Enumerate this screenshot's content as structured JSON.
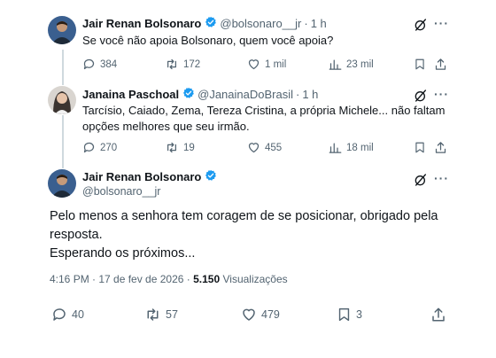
{
  "tweets": [
    {
      "name": "Jair Renan Bolsonaro",
      "handle": "@bolsonaro__jr",
      "separator": "·",
      "time": "1 h",
      "text": "Se você não apoia Bolsonaro, quem você apoia?",
      "actions": {
        "replies": "384",
        "retweets": "172",
        "likes": "1 mil",
        "views": "23 mil"
      }
    },
    {
      "name": "Janaina Paschoal",
      "handle": "@JanainaDoBrasil",
      "separator": "·",
      "time": "1 h",
      "text_line1": "Tarcísio, Caiado, Zema, Tereza Cristina, a própria Michele... não faltam",
      "text_line2": "opções melhores que seu irmão.",
      "actions": {
        "replies": "270",
        "retweets": "19",
        "likes": "455",
        "views": "18 mil"
      }
    }
  ],
  "main_tweet": {
    "name": "Jair Renan Bolsonaro",
    "handle": "@bolsonaro__jr",
    "text_line1": "Pelo menos a senhora tem coragem de se posicionar, obrigado pela",
    "text_line2": "resposta.",
    "text_line3": "Esperando os próximos...",
    "timestamp": "4:16 PM · 17 de fev de 2026 ·",
    "views_count": "5.150",
    "views_label": "Visualizações",
    "actions": {
      "replies": "40",
      "retweets": "57",
      "likes": "479",
      "bookmarks": "3"
    }
  },
  "colors": {
    "verified": "#1d9bf0",
    "muted": "#536471",
    "text": "#0f1419",
    "thread_line": "#cfd9de"
  },
  "icons": [
    "verified-badge-icon",
    "grok-icon",
    "reply-icon",
    "retweet-icon",
    "like-icon",
    "views-icon",
    "bookmark-icon",
    "share-icon"
  ]
}
